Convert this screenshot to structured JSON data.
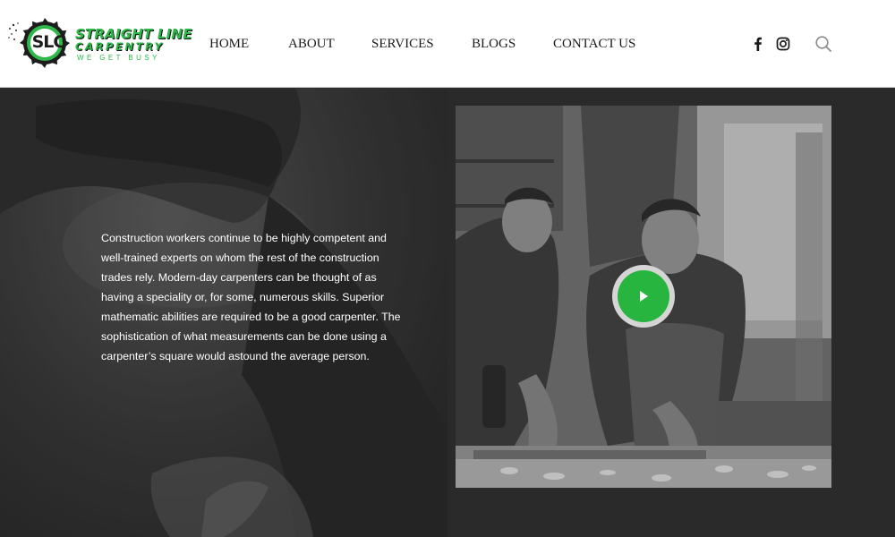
{
  "brand": {
    "name_line1": "STRAIGHT LINE",
    "name_line2": "CARPENTRY",
    "tagline": "WE GET BUSY",
    "monogram": "SLC",
    "accent_color": "#2fb84a"
  },
  "nav": {
    "items": [
      {
        "label": "HOME"
      },
      {
        "label": "ABOUT"
      },
      {
        "label": "SERVICES"
      },
      {
        "label": "BLOGS"
      },
      {
        "label": "CONTACT US"
      }
    ]
  },
  "header_icons": {
    "facebook": "facebook-icon",
    "instagram": "instagram-icon",
    "search": "search-icon"
  },
  "hero": {
    "paragraph": "Construction workers continue to be highly competent and well-trained experts on whom the rest of the construction trades rely. Modern-day carpenters can be thought of as having a speciality or, for some, numerous skills. Superior mathematic abilities are required to be a good carpenter. The sophistication of what measurements can be done using a carpenter’s square would astound the average person.",
    "video": {
      "play_icon": "play-icon",
      "play_color": "#27b43f"
    }
  }
}
